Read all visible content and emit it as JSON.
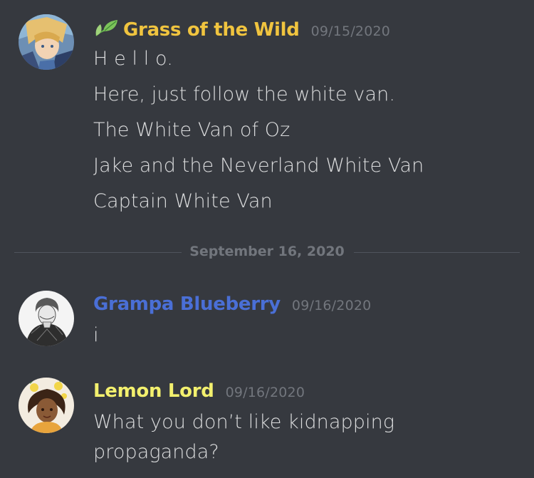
{
  "messages": [
    {
      "username": "Grass of the Wild",
      "username_color": "#f0c43f",
      "avatar_icon": "elf-warrior-avatar",
      "name_emoji": "leaf-icon",
      "timestamp": "09/15/2020",
      "lines": [
        "H e l l o.",
        "Here, just follow the white van.",
        "The White Van of Oz",
        "Jake and the Neverland White Van",
        "Captain White Van"
      ]
    },
    {
      "username": "Grampa Blueberry",
      "username_color": "#4a6fd6",
      "avatar_icon": "sketch-portrait-avatar",
      "timestamp": "09/16/2020",
      "lines": [
        "i"
      ]
    },
    {
      "username": "Lemon Lord",
      "username_color": "#f3f06e",
      "avatar_icon": "lemon-girl-avatar",
      "timestamp": "09/16/2020",
      "lines": [
        "What you don’t like kidnapping",
        "propaganda?"
      ]
    }
  ],
  "divider": {
    "date": "September 16, 2020"
  },
  "colors": {
    "background": "#36393f",
    "text": "#dcddde",
    "muted": "#72767d",
    "divider": "#4f545c"
  }
}
